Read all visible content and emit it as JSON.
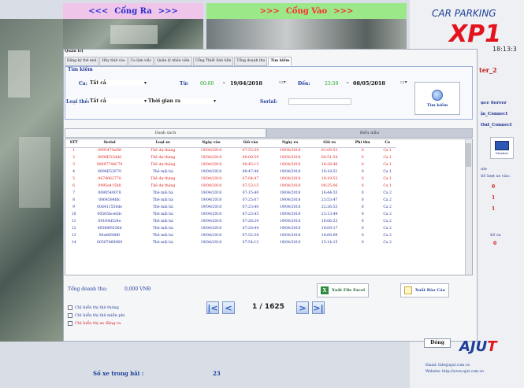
{
  "banners": {
    "out": "Cổng Ra",
    "in": "Cổng Vào",
    "out_arrows_left": "<<<",
    "out_arrows_right": ">>>",
    "in_arrows_left": ">>>",
    "in_arrows_right": ">>>"
  },
  "brand": {
    "title": "CAR PARKING",
    "model": "XP1",
    "clock": "18:13:3",
    "user": "ter_2"
  },
  "side": {
    "links": [
      "ụce Server",
      "ịn_Connect",
      "Out_Connect"
    ],
    "monitor_caption": "Monitor",
    "note1": "ule",
    "note2": "Số lượt xe vào:",
    "mark1": "0",
    "mark2": "1",
    "mark3": "1",
    "note3": "Số ra",
    "mark4": "0"
  },
  "window": {
    "title": "Quản trị"
  },
  "tabs": [
    "Đăng ký thẻ mới",
    "Hủy tình vào",
    "Ca làm việc",
    "Quản lý nhân viên",
    "Cổng Thiết lình tiền",
    "Tổng doanh thu",
    "Tìm kiếm"
  ],
  "search": {
    "legend": "Tìm kiếm",
    "lane_label": "Ca:",
    "lane_value": "Tất cả",
    "from_label": "Từ:",
    "from_time": "00:00",
    "from_date": "19/04/2018",
    "to_label": "Đến:",
    "to_time": "23:59",
    "to_date": "08/05/2018",
    "cardtype_label": "Loại thẻ:",
    "cardtype_value": "Tất cả",
    "mode_value": "Thời gian ra",
    "serial_label": "Serial:",
    "serial_value": "",
    "button": "Tìm kiếm"
  },
  "list_tabs": {
    "list": "Danh sách",
    "stats": "Biểu mẫu"
  },
  "table": {
    "headers": [
      "STT",
      "Serial",
      "Loại xe",
      "Ngày vào",
      "Giờ vào",
      "Ngày ra",
      "Giờ ra",
      "Phí thu",
      "Ca"
    ],
    "rows": [
      {
        "style": "red",
        "cells": [
          "1",
          "0995474aD8",
          "Thẻ dự tháng",
          "19/04/2018",
          "07:53:59",
          "19/04/2018",
          "01:09:53",
          "0",
          "Ca 1"
        ]
      },
      {
        "style": "red",
        "cells": [
          "2",
          "0096E53ddd",
          "Thẻ dự tháng",
          "19/04/2018",
          "00:00:59",
          "19/04/2018",
          "00:51:54",
          "0",
          "Ca 1"
        ]
      },
      {
        "style": "red",
        "cells": [
          "3",
          "00097748C70",
          "Thẻ dự tháng",
          "19/04/2018",
          "00:45:13",
          "19/04/2018",
          "18:28:46",
          "0",
          "Ca 1"
        ]
      },
      {
        "style": "blue",
        "cells": [
          "4",
          "0096E53F70",
          "Thẻ mãi hà",
          "19/04/2018",
          "00:47:46",
          "19/04/2018",
          "10:18:51",
          "0",
          "Ca 1"
        ]
      },
      {
        "style": "red",
        "cells": [
          "5",
          "0674062770",
          "Thẻ dự tháng",
          "19/04/2018",
          "07:04:47",
          "19/04/2018",
          "18:19:53",
          "0",
          "Ca 1"
        ]
      },
      {
        "style": "red",
        "cells": [
          "6",
          "0995e415h8",
          "Thẻ dự tháng",
          "19/04/2018",
          "07:53:15",
          "19/04/2018",
          "09:35:06",
          "0",
          "Ca 1"
        ]
      },
      {
        "style": "blue",
        "cells": [
          "7",
          "0080540078",
          "Thẻ mãi hà",
          "19/04/2018",
          "07:15:40",
          "19/04/2018",
          "18:44:55",
          "0",
          "Ca 2"
        ]
      },
      {
        "style": "blue",
        "cells": [
          "8",
          "0064584fdc",
          "Thẻ mãi hà",
          "19/04/2018",
          "07:25:07",
          "19/04/2018",
          "23:53:47",
          "0",
          "Ca 2"
        ]
      },
      {
        "style": "blue",
        "cells": [
          "9",
          "00d411550de",
          "Thẻ mãi hà",
          "19/04/2018",
          "07:23:40",
          "19/04/2018",
          "22:26:53",
          "0",
          "Ca 2"
        ]
      },
      {
        "style": "blue",
        "cells": [
          "10",
          "00565bce0dc",
          "Thẻ mãi hà",
          "19/04/2018",
          "07:23:45",
          "19/04/2018",
          "23:13:44",
          "0",
          "Ca 2"
        ]
      },
      {
        "style": "blue",
        "cells": [
          "11",
          "00164d524e",
          "Thẻ mãi hà",
          "19/04/2018",
          "07:26:29",
          "19/04/2018",
          "18:06:23",
          "0",
          "Ca 2"
        ]
      },
      {
        "style": "blue",
        "cells": [
          "12",
          "00568f9256d",
          "Thẻ mãi hà",
          "19/04/2018",
          "07:20:44",
          "19/04/2018",
          "18:09:17",
          "0",
          "Ca 2"
        ]
      },
      {
        "style": "blue",
        "cells": [
          "13",
          "00a46688D",
          "Thẻ mãi hà",
          "19/04/2018",
          "07:52:38",
          "19/04/2018",
          "18:00:09",
          "0",
          "Ca 2"
        ]
      },
      {
        "style": "blue",
        "cells": [
          "14",
          "00507469960",
          "Thẻ mãi hà",
          "19/04/2018",
          "07:54:12",
          "19/04/2018",
          "15:14:15",
          "0",
          "Ca 2"
        ]
      }
    ]
  },
  "summary": {
    "label": "Tổng doanh thu:",
    "value": "0,000 VNĐ"
  },
  "actions": {
    "export": "Xuất File Excel",
    "report": "Xuất Báo Cáo"
  },
  "checks": [
    "Chỉ hiển thị thẻ tháng",
    "Chỉ hiển thị thẻ miễn phí",
    "Chỉ hiển thị xe đăng ra"
  ],
  "pager": {
    "text": "1 / 1625"
  },
  "footer": {
    "count_label": "Số xe trong bãi :",
    "count_value": "23",
    "close": "Đóng",
    "logo_main": "AJU",
    "logo_accent": "T",
    "email": "Email: Info@ajut.com.vn",
    "website": "Website: http://www.ajut.com.vn"
  },
  "colors": {
    "accent": "#1f3f98",
    "brand_red": "#e3121c",
    "out_banner": "#efc6ea",
    "in_banner": "#9be889"
  }
}
